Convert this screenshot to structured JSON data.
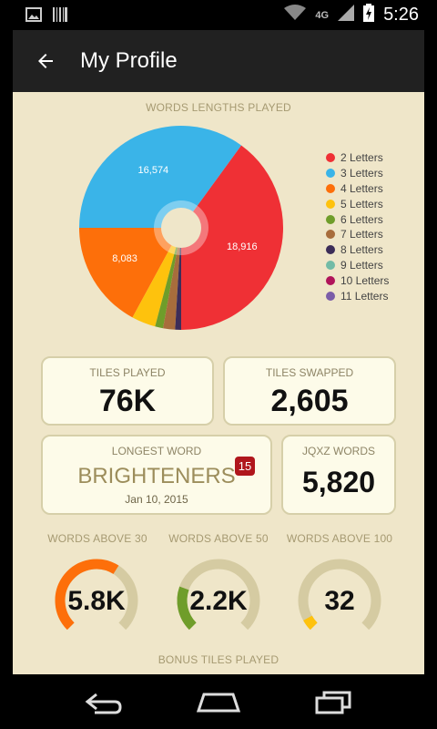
{
  "status_bar": {
    "time": "5:26",
    "network": "4G",
    "icons": [
      "image-icon",
      "barcode-icon",
      "wifi-icon",
      "signal-icon",
      "battery-charging-icon"
    ]
  },
  "app_bar": {
    "title": "My Profile",
    "back_icon": "arrow-back-icon"
  },
  "words_lengths": {
    "title": "WORDS LENGTHS PLAYED"
  },
  "chart_data": {
    "type": "pie",
    "title": "WORDS LENGTHS PLAYED",
    "slices": [
      {
        "label": "2 Letters",
        "value": 18916,
        "display": "18,916",
        "color": "#ef3035"
      },
      {
        "label": "3 Letters",
        "value": 16574,
        "display": "16,574",
        "color": "#3ab4e8"
      },
      {
        "label": "4 Letters",
        "value": 8083,
        "display": "8,083",
        "color": "#fd6f0a"
      },
      {
        "label": "5 Letters",
        "value": 1800,
        "display": "",
        "color": "#fec20d"
      },
      {
        "label": "6 Letters",
        "value": 600,
        "display": "",
        "color": "#6f9d2a"
      },
      {
        "label": "7 Letters",
        "value": 900,
        "display": "",
        "color": "#a86d3c"
      },
      {
        "label": "8 Letters",
        "value": 450,
        "display": "",
        "color": "#3c2d58"
      },
      {
        "label": "9 Letters",
        "value": 0,
        "display": "",
        "color": "#72bba6"
      },
      {
        "label": "10 Letters",
        "value": 0,
        "display": "",
        "color": "#b0145a"
      },
      {
        "label": "11 Letters",
        "value": 0,
        "display": "",
        "color": "#7b5da8"
      }
    ],
    "legend_position": "right"
  },
  "tiles_played": {
    "label": "TILES PLAYED",
    "value": "76K"
  },
  "tiles_swapped": {
    "label": "TILES SWAPPED",
    "value": "2,605"
  },
  "longest_word": {
    "label": "LONGEST WORD",
    "word": "BRIGHTENERS",
    "score": "15",
    "date": "Jan 10, 2015"
  },
  "jqxz_words": {
    "label": "JQXZ WORDS",
    "value": "5,820"
  },
  "gauges": [
    {
      "label": "WORDS ABOVE 30",
      "value": "5.8K",
      "fraction": 0.62,
      "color": "#fd6f0a"
    },
    {
      "label": "WORDS ABOVE 50",
      "value": "2.2K",
      "fraction": 0.24,
      "color": "#6f9d2a"
    },
    {
      "label": "WORDS ABOVE 100",
      "value": "32",
      "fraction": 0.06,
      "color": "#fec20d"
    }
  ],
  "bonus_tiles": {
    "title": "BONUS TILES PLAYED"
  },
  "nav_bar": {
    "icons": [
      "back-nav-icon",
      "home-nav-icon",
      "recents-nav-icon"
    ]
  }
}
